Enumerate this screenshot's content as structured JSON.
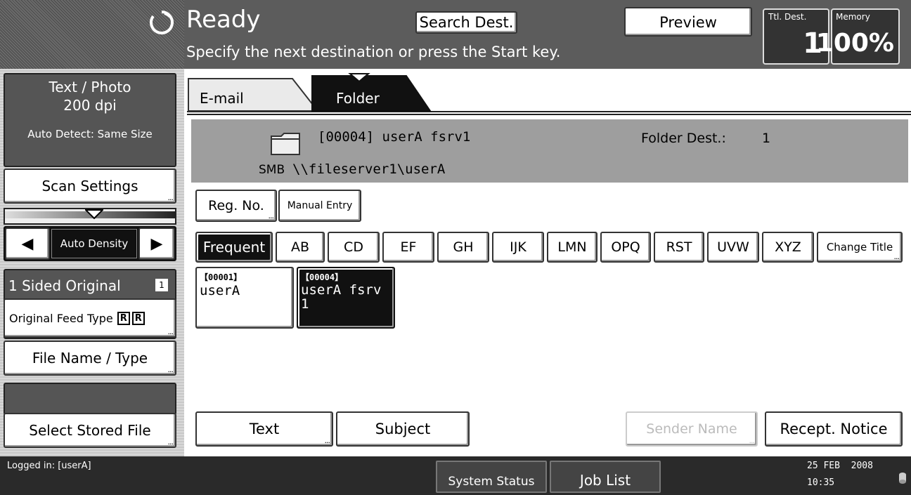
{
  "header": {
    "status": "Ready",
    "message": "Specify the next destination or press the Start key.",
    "search_dest_label": "Search Dest.",
    "preview_label": "Preview",
    "ttl_dest_label": "Ttl. Dest.",
    "ttl_dest_value": "1",
    "memory_label": "Memory",
    "memory_value": "100%"
  },
  "left": {
    "scan_mode": "Text / Photo",
    "resolution": "200 dpi",
    "size_mode": "Auto Detect: Same Size",
    "scan_settings_label": "Scan Settings",
    "density_label": "Auto Density",
    "original_label": "1 Sided Original",
    "feed_type_label": "Original Feed Type",
    "file_name_label": "File Name / Type",
    "select_stored_label": "Select Stored File"
  },
  "tabs": [
    {
      "label": "E-mail",
      "active": false
    },
    {
      "label": "Folder",
      "active": true
    }
  ],
  "dest": {
    "title": "[00004] userA fsrv1",
    "protocol": "SMB",
    "path": "\\\\fileserver1\\userA",
    "count_label": "Folder Dest.:",
    "count_value": "1"
  },
  "entry": {
    "reg_no_label": "Reg. No.",
    "manual_entry_label": "Manual Entry"
  },
  "index_tabs": [
    "Frequent",
    "AB",
    "CD",
    "EF",
    "GH",
    "IJK",
    "LMN",
    "OPQ",
    "RST",
    "UVW",
    "XYZ",
    "Change Title"
  ],
  "destinations": [
    {
      "id": "【00001】",
      "name": "userA",
      "name2": "",
      "selected": false
    },
    {
      "id": "【00004】",
      "name": "userA fsrv",
      "name2": "1",
      "selected": true
    }
  ],
  "bottom_buttons": {
    "text_label": "Text",
    "subject_label": "Subject",
    "sender_label": "Sender Name",
    "recept_label": "Recept. Notice"
  },
  "footer": {
    "logged_in": "Logged in: [userA]",
    "system_status_label": "System Status",
    "job_list_label": "Job List",
    "date": "25 FEB  2008",
    "time": "10:35"
  },
  "colors": {
    "header_bg": "#5c5c5c",
    "dest_panel_bg": "#9e9e9e",
    "selected_bg": "#111111"
  }
}
